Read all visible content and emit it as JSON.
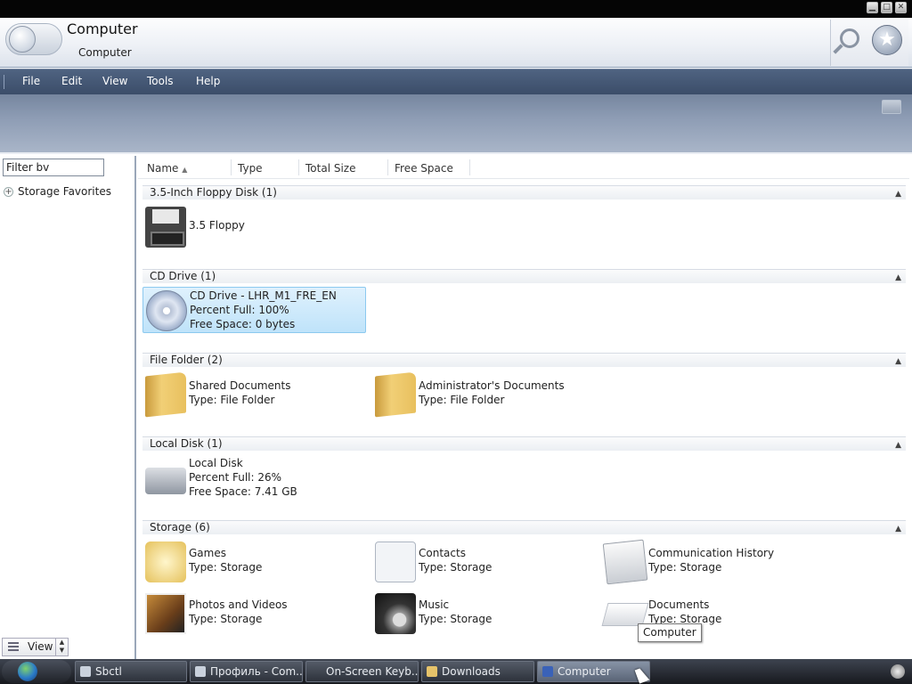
{
  "window": {
    "title": "Computer",
    "subtitle": "Computer"
  },
  "window_controls": {
    "minimize": "▁",
    "maximize": "□",
    "close": "✕"
  },
  "menu": [
    "File",
    "Edit",
    "View",
    "Tools",
    "Help"
  ],
  "left_pane": {
    "filter_value": "Filter bv",
    "favorites_label": "Storage Favorites",
    "view_label": "View"
  },
  "columns": [
    "Name",
    "Type",
    "Total Size",
    "Free Space"
  ],
  "groups": [
    {
      "title": "3.5-Inch Floppy Disk (1)",
      "items": [
        {
          "icon": "floppy-icon",
          "lines": [
            "3.5 Floppy"
          ]
        }
      ]
    },
    {
      "title": "CD Drive (1)",
      "items": [
        {
          "icon": "cd-drive-icon",
          "selected": true,
          "lines": [
            "CD Drive - LHR_M1_FRE_EN",
            "Percent Full: 100%",
            "Free Space: 0 bytes"
          ]
        }
      ]
    },
    {
      "title": "File Folder (2)",
      "items": [
        {
          "icon": "folder-icon",
          "lines": [
            "Shared Documents",
            "Type: File Folder"
          ]
        },
        {
          "icon": "folder-icon",
          "lines": [
            "Administrator's Documents",
            "Type: File Folder"
          ]
        }
      ]
    },
    {
      "title": "Local Disk (1)",
      "items": [
        {
          "icon": "hard-disk-icon",
          "lines": [
            "Local Disk",
            "Percent Full: 26%",
            "Free Space: 7.41 GB"
          ]
        }
      ]
    },
    {
      "title": "Storage (6)",
      "items": [
        {
          "icon": "games-icon",
          "lines": [
            "Games",
            "Type: Storage"
          ]
        },
        {
          "icon": "contacts-icon",
          "lines": [
            "Contacts",
            "Type: Storage"
          ]
        },
        {
          "icon": "mail-icon",
          "lines": [
            "Communication History",
            "Type: Storage"
          ]
        },
        {
          "icon": "photos-icon",
          "lines": [
            "Photos and Videos",
            "Type: Storage"
          ]
        },
        {
          "icon": "music-icon",
          "lines": [
            "Music",
            "Type: Storage"
          ]
        },
        {
          "icon": "documents-icon",
          "lines": [
            "Documents",
            "Type: Storage"
          ]
        }
      ]
    }
  ],
  "tooltip": "Computer",
  "taskbar": {
    "tasks": [
      "Sbctl",
      "Профиль - Com...",
      "On-Screen Keyb...",
      "Downloads",
      "Computer"
    ],
    "active": "Computer"
  }
}
